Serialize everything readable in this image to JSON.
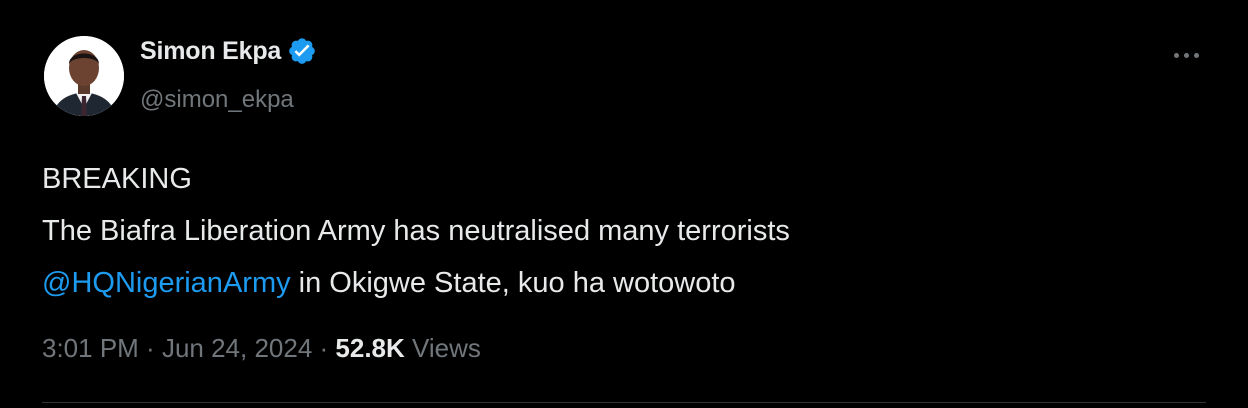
{
  "tweet": {
    "author": {
      "name": "Simon Ekpa",
      "handle": "@simon_ekpa",
      "verified": true,
      "verified_color": "#1d9bf0"
    },
    "more_icon": "more-horizontal-icon",
    "text": {
      "line1": "BREAKING",
      "line2": "The Biafra Liberation Army has neutralised many terrorists",
      "mention": "@HQNigerianArmy",
      "line3_rest": " in Okigwe State, kuo ha wotowoto"
    },
    "meta": {
      "time": "3:01 PM",
      "separator": " · ",
      "date": "Jun 24, 2024",
      "views_count": "52.8K",
      "views_label": " Views"
    }
  },
  "colors": {
    "background": "#000000",
    "text": "#e7e9ea",
    "muted": "#71767b",
    "link": "#1d9bf0"
  }
}
